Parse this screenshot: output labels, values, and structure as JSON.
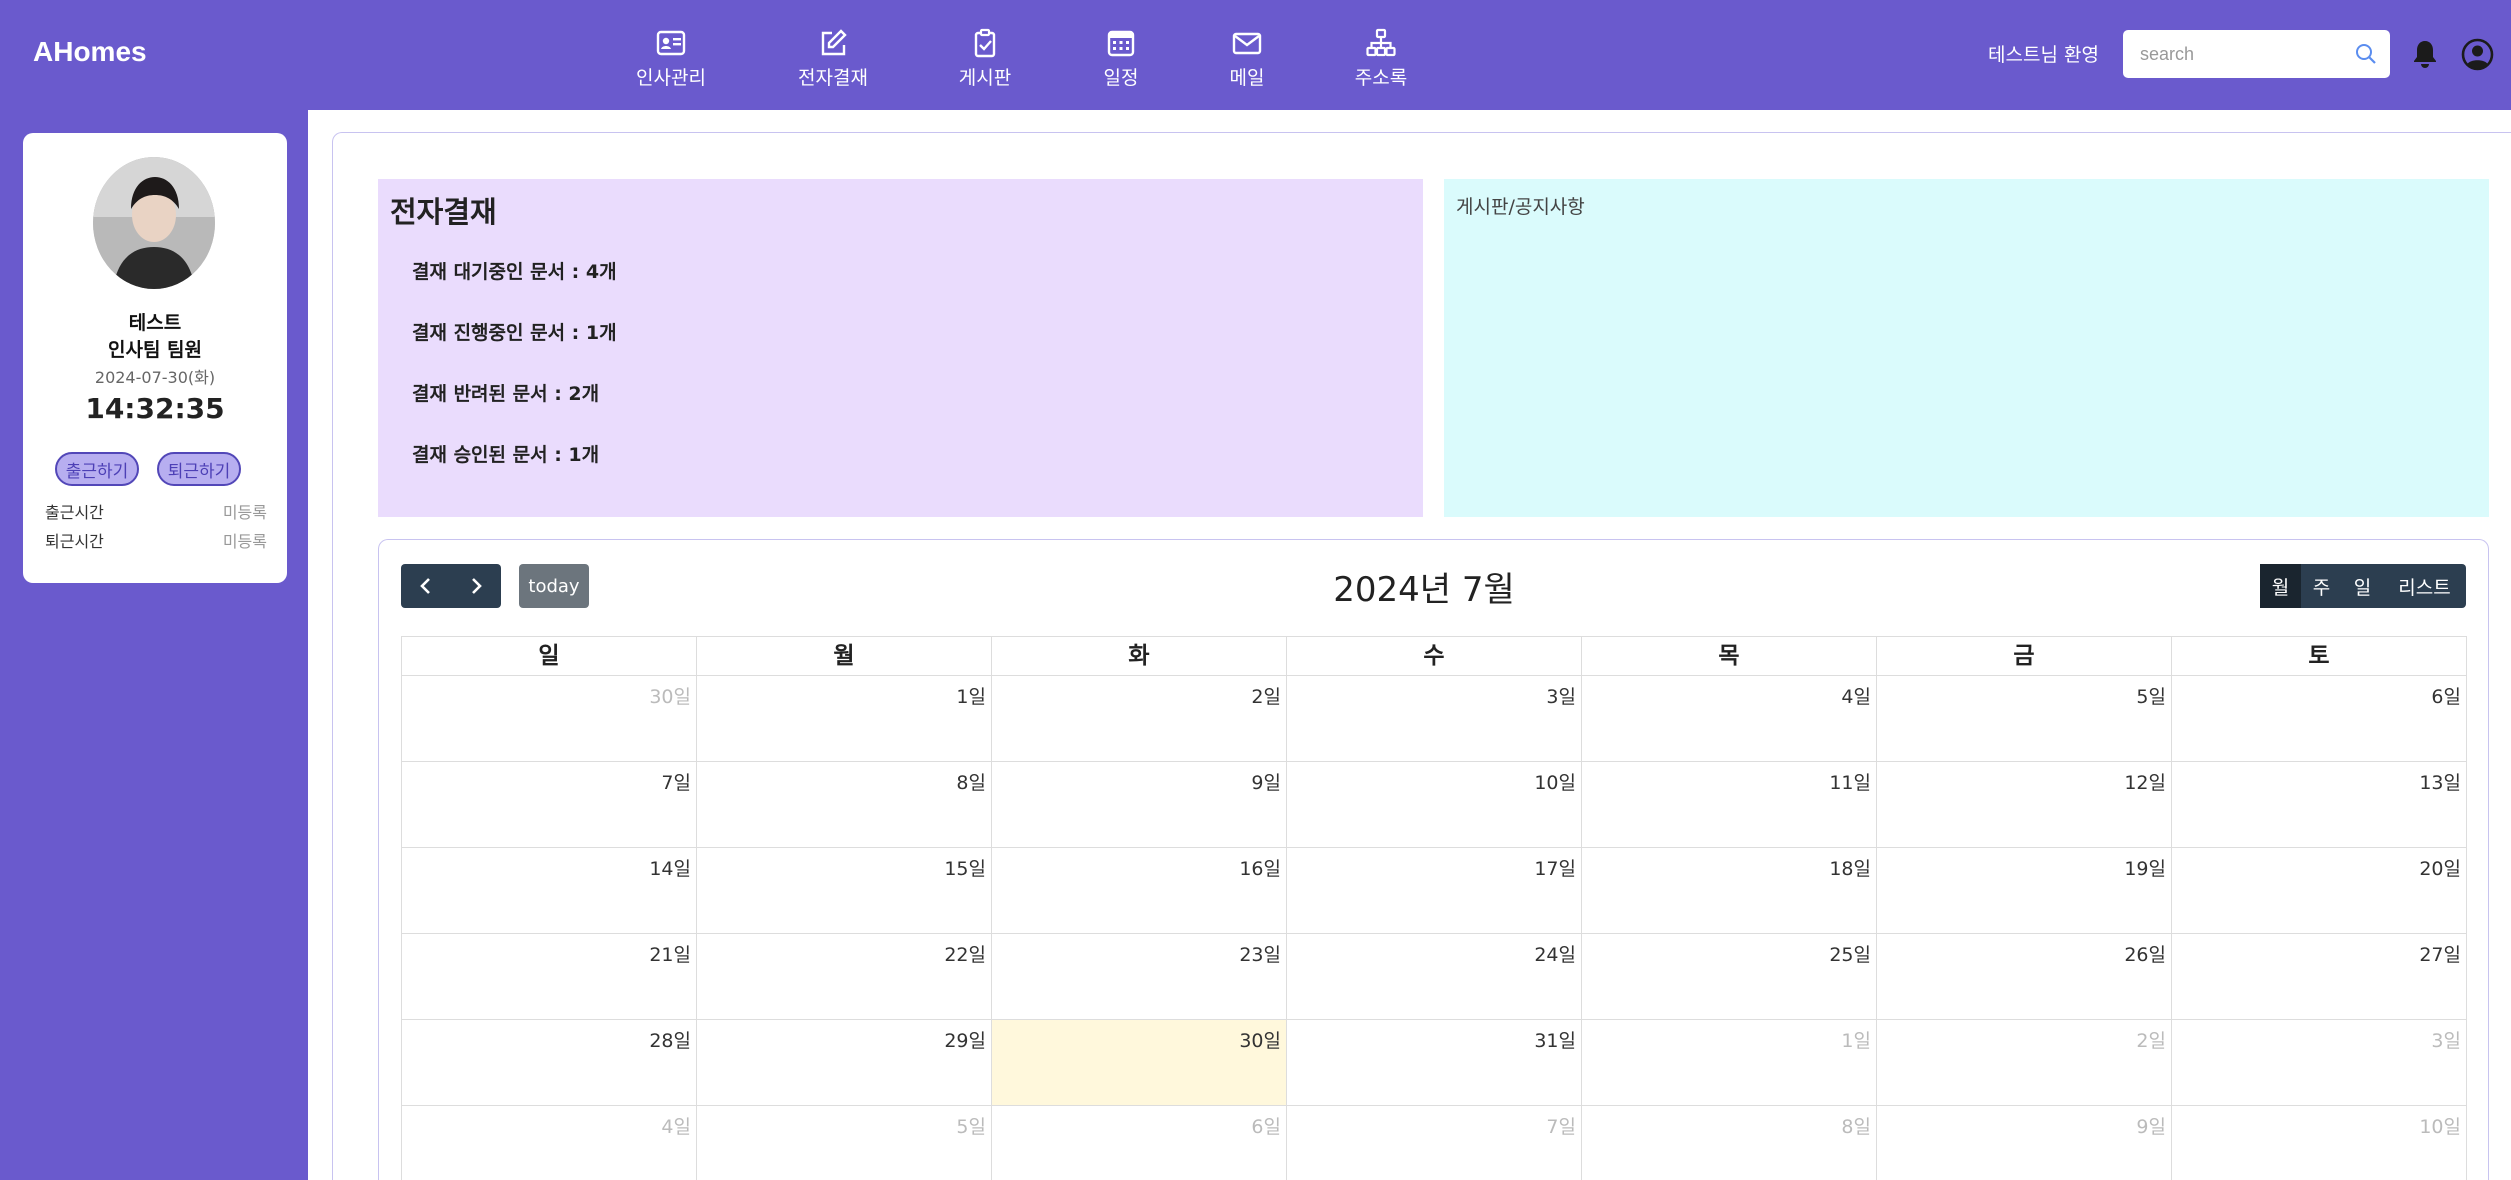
{
  "header": {
    "brand": "AHomes",
    "nav": [
      {
        "label": "인사관리",
        "icon": "person-card-icon"
      },
      {
        "label": "전자결재",
        "icon": "edit-icon"
      },
      {
        "label": "게시판",
        "icon": "clipboard-check-icon"
      },
      {
        "label": "일정",
        "icon": "calendar-icon"
      },
      {
        "label": "메일",
        "icon": "envelope-icon"
      },
      {
        "label": "주소록",
        "icon": "org-chart-icon"
      }
    ],
    "welcome": "테스트님 환영",
    "search_placeholder": "search"
  },
  "profile": {
    "name": "테스트",
    "team": "인사팀 팀원",
    "date": "2024-07-30(화)",
    "clock": "14:32:35",
    "checkin_label": "출근하기",
    "checkout_label": "퇴근하기",
    "checkin_time_label": "출근시간",
    "checkin_time_value": "미등록",
    "checkout_time_label": "퇴근시간",
    "checkout_time_value": "미등록"
  },
  "approval": {
    "title": "전자결재",
    "lines": [
      "결재 대기중인 문서 : 4개",
      "결재 진행중인 문서 : 1개",
      "결재 반려된 문서 : 2개",
      "결재 승인된 문서 : 1개"
    ]
  },
  "notice": {
    "title": "게시판/공지사항"
  },
  "calendar": {
    "title": "2024년 7월",
    "today_label": "today",
    "views": [
      "월",
      "주",
      "일",
      "리스트"
    ],
    "active_view": "월",
    "weekdays": [
      "일",
      "월",
      "화",
      "수",
      "목",
      "금",
      "토"
    ],
    "weeks": [
      [
        {
          "d": "30일",
          "o": true
        },
        {
          "d": "1일"
        },
        {
          "d": "2일"
        },
        {
          "d": "3일"
        },
        {
          "d": "4일"
        },
        {
          "d": "5일"
        },
        {
          "d": "6일"
        }
      ],
      [
        {
          "d": "7일"
        },
        {
          "d": "8일"
        },
        {
          "d": "9일"
        },
        {
          "d": "10일"
        },
        {
          "d": "11일"
        },
        {
          "d": "12일"
        },
        {
          "d": "13일"
        }
      ],
      [
        {
          "d": "14일"
        },
        {
          "d": "15일"
        },
        {
          "d": "16일"
        },
        {
          "d": "17일"
        },
        {
          "d": "18일"
        },
        {
          "d": "19일"
        },
        {
          "d": "20일"
        }
      ],
      [
        {
          "d": "21일"
        },
        {
          "d": "22일"
        },
        {
          "d": "23일"
        },
        {
          "d": "24일"
        },
        {
          "d": "25일"
        },
        {
          "d": "26일"
        },
        {
          "d": "27일"
        }
      ],
      [
        {
          "d": "28일"
        },
        {
          "d": "29일"
        },
        {
          "d": "30일",
          "t": true
        },
        {
          "d": "31일"
        },
        {
          "d": "1일",
          "o": true
        },
        {
          "d": "2일",
          "o": true
        },
        {
          "d": "3일",
          "o": true
        }
      ],
      [
        {
          "d": "4일",
          "o": true
        },
        {
          "d": "5일",
          "o": true
        },
        {
          "d": "6일",
          "o": true
        },
        {
          "d": "7일",
          "o": true
        },
        {
          "d": "8일",
          "o": true
        },
        {
          "d": "9일",
          "o": true
        },
        {
          "d": "10일",
          "o": true
        }
      ]
    ]
  }
}
